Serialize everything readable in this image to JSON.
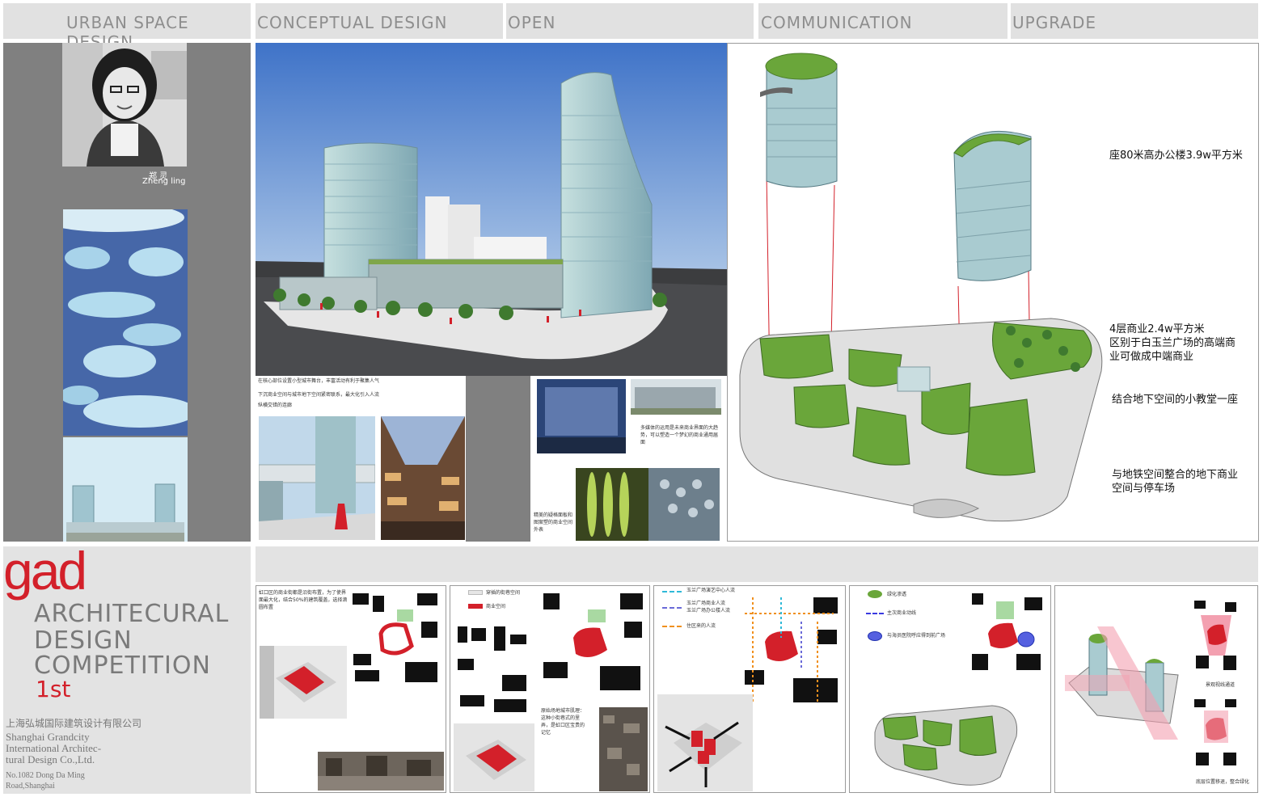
{
  "tabs": [
    "URBAN SPACE DESIGN",
    "CONCEPTUAL DESIGN",
    "OPEN",
    "COMMUNICATION",
    "UPGRADE"
  ],
  "profile": {
    "name_cn": "郑 灵",
    "name_en": "Zheng ling"
  },
  "branding": {
    "logo": "gad",
    "line1": "ARCHITECURAL",
    "line2": "DESIGN",
    "line3": "COMPETITION",
    "rank": "1st",
    "company_cn": "上海弘城国际建筑设计有限公司",
    "company_en_1": "Shanghai Grandcity",
    "company_en_2": "International Architec-",
    "company_en_3": "tural Design Co.,Ltd.",
    "address_1": "No.1082 Dong Da Ming",
    "address_2": "Road,Shanghai"
  },
  "concept_notes": {
    "line1": "在核心部位设置小型城市舞台，丰富活动有利于聚集人气",
    "line2": "下沉商业空间与城市地下空间紧密联系，最大化引入人流",
    "line3": "纵横交错的连廊"
  },
  "facade_notes": {
    "note1": "多媒体的运用是未来商业界面的大趋势，可以塑造一个梦幻的商业通用届面",
    "note2": "精美的疑格面板和图案塑的商业空间外表"
  },
  "axo_labels": {
    "office": "座80米高办公楼3.9w平方米",
    "retail_1": "4层商业2.4w平方米",
    "retail_2": "区别于白玉兰广场的高端商",
    "retail_3": "业可做成中端商业",
    "church": "结合地下空间的小教堂一座",
    "metro_1": "与地铁空间整合的地下商业",
    "metro_2": "空间与停车场"
  },
  "strip": {
    "p1": "虹口区的商业街都是沿街布置，为了使界面最大化，结合50%的建筑覆盖，选择滴圆布置",
    "p2_legend1": "穿插的街巷空间",
    "p2_legend2": "商业空间",
    "p2_note": "原始场地城市肌理：这种小街巷式的里弄，是虹口区宝贵的记忆",
    "p3_legend1": "玉兰广场演艺中心人流",
    "p3_legend2": "玉兰广场商业人流",
    "p3_legend2b": "玉兰广场办公楼人流",
    "p3_legend3": "住区来的人流",
    "p4_legend1": "绿化渗透",
    "p4_legend2": "主次商业动线",
    "p4_legend3": "与海员医院呼应得到前广场",
    "p5_note1": "景观视线通道",
    "p5_note2": "底层位置移退，整合绿化"
  },
  "colors": {
    "accent_red": "#d3202a",
    "tab_bg": "#e1e1e1",
    "tab_text": "#8e8e8e",
    "sidebar_gray": "#808080",
    "roof_green": "#6aa63a",
    "glass": "#a9cbd0"
  }
}
